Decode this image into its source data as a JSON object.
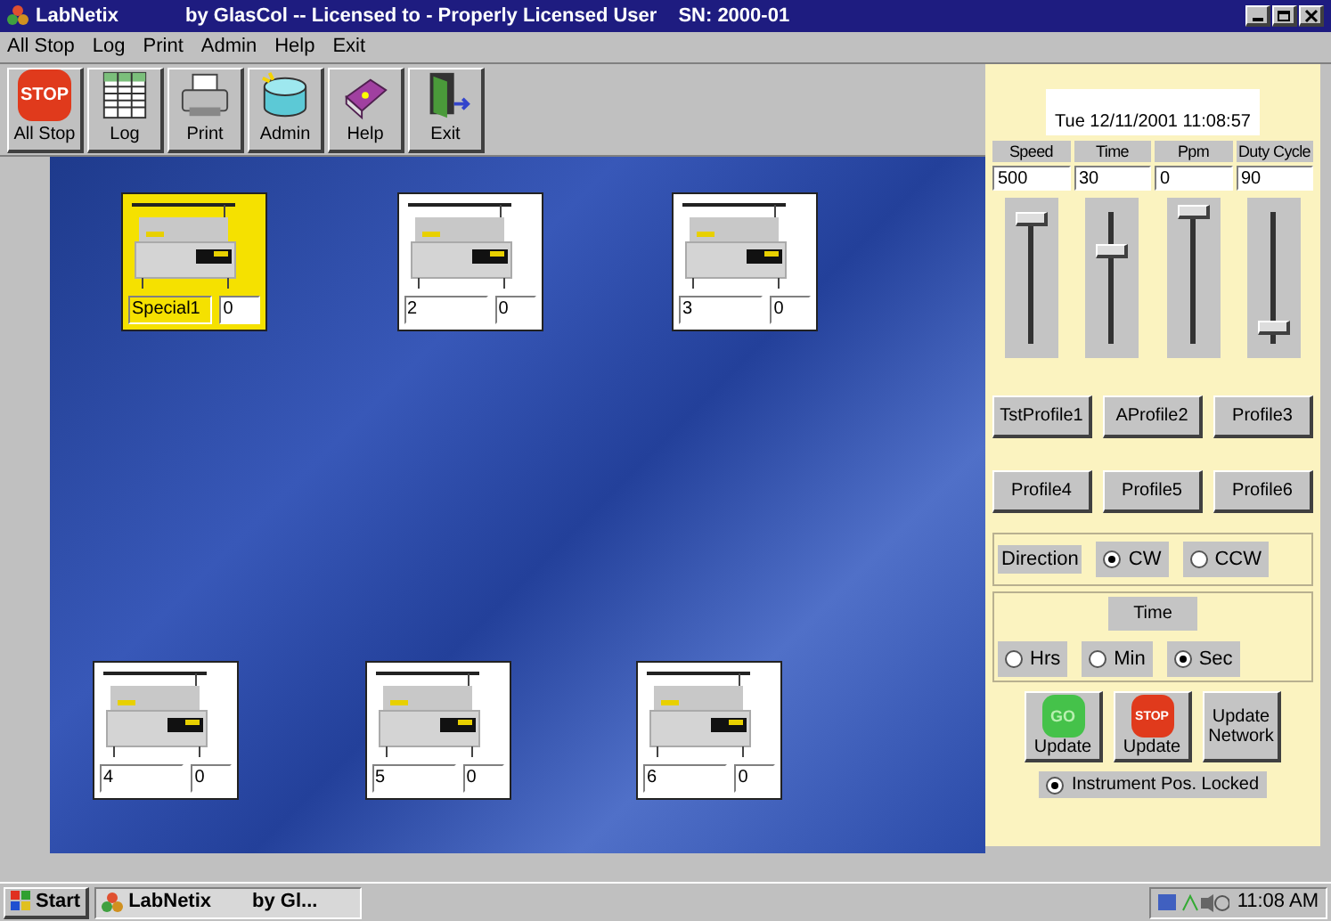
{
  "window": {
    "title": "LabNetix",
    "subtitle": "by GlasCol -- Licensed to - Properly Licensed User",
    "serial": "SN: 2000-01"
  },
  "menu": [
    "All Stop",
    "Log",
    "Print",
    "Admin",
    "Help",
    "Exit"
  ],
  "toolbar": [
    {
      "kind": "stop",
      "icon_text": "STOP",
      "label": "All Stop"
    },
    {
      "kind": "log",
      "label": "Log"
    },
    {
      "kind": "print",
      "label": "Print"
    },
    {
      "kind": "admin",
      "label": "Admin"
    },
    {
      "kind": "help",
      "label": "Help"
    },
    {
      "kind": "exit",
      "label": "Exit"
    }
  ],
  "instruments": [
    {
      "name": "Special1",
      "count": "0",
      "selected": true
    },
    {
      "name": "2",
      "count": "0",
      "selected": false
    },
    {
      "name": "3",
      "count": "0",
      "selected": false
    },
    {
      "name": "4",
      "count": "0",
      "selected": false
    },
    {
      "name": "5",
      "count": "0",
      "selected": false
    },
    {
      "name": "6",
      "count": "0",
      "selected": false
    }
  ],
  "panel": {
    "datetime": "Tue 12/11/2001 11:08:57",
    "controls": [
      {
        "label": "Speed",
        "value": "500",
        "level": 0.95
      },
      {
        "label": "Time",
        "value": "30",
        "level": 0.7
      },
      {
        "label": "Ppm",
        "value": "0",
        "level": 1
      },
      {
        "label": "Duty Cycle",
        "value": "90",
        "level": 0.12
      }
    ],
    "profiles": [
      "TstProfile1",
      "AProfile2",
      "Profile3",
      "Profile4",
      "Profile5",
      "Profile6"
    ],
    "direction": {
      "label": "Direction",
      "options": [
        {
          "label": "CW",
          "selected": true
        },
        {
          "label": "CCW",
          "selected": false
        }
      ]
    },
    "time_unit": {
      "label": "Time",
      "options": [
        {
          "label": "Hrs",
          "selected": false
        },
        {
          "label": "Min",
          "selected": false
        },
        {
          "label": "Sec",
          "selected": true
        }
      ]
    },
    "actions": [
      {
        "kind": "go",
        "icon_text": "GO",
        "label": "Update"
      },
      {
        "kind": "stop",
        "icon_text": "STOP",
        "label": "Update"
      },
      {
        "kind": "plain",
        "label": "Update Network"
      }
    ],
    "lock": {
      "label": "Instrument Pos. Locked",
      "checked": true
    }
  },
  "taskbar": {
    "start": "Start",
    "tasks": [
      {
        "label": "LabNetix",
        "sublabel": "by Gl..."
      }
    ],
    "clock": "11:08 AM"
  }
}
